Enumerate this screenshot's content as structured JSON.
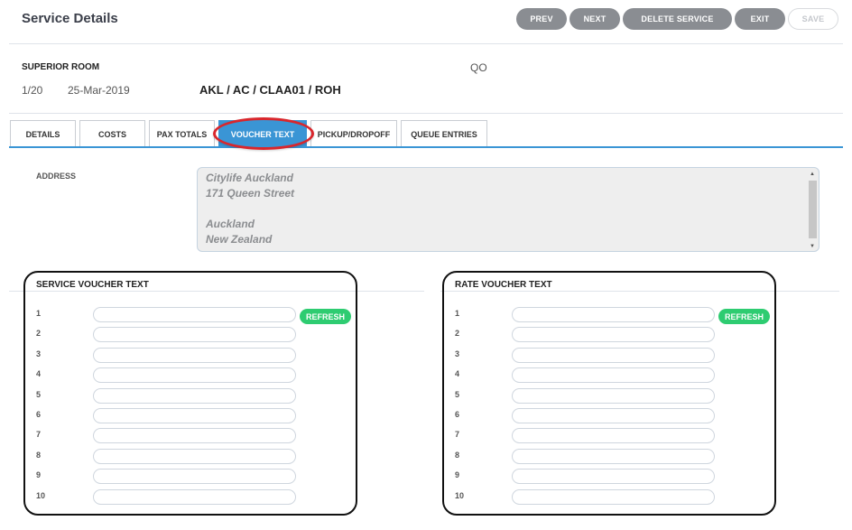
{
  "page": {
    "title": "Service Details"
  },
  "toolbar": {
    "prev": "PREV",
    "next": "NEXT",
    "delete": "DELETE SERVICE",
    "exit": "EXIT",
    "save": "SAVE"
  },
  "service": {
    "room": "SUPERIOR ROOM",
    "code": "QO",
    "index": "1/20",
    "date": "25-Mar-2019",
    "route": "AKL / AC / CLAA01 / ROH"
  },
  "tabs": [
    {
      "label": "DETAILS",
      "active": false
    },
    {
      "label": "COSTS",
      "active": false
    },
    {
      "label": "PAX TOTALS",
      "active": false
    },
    {
      "label": "VOUCHER TEXT",
      "active": true
    },
    {
      "label": "PICKUP/DROPOFF",
      "active": false
    },
    {
      "label": "QUEUE ENTRIES",
      "active": false
    }
  ],
  "address": {
    "label": "ADDRESS",
    "lines": [
      "Citylife Auckland",
      "171 Queen Street",
      "",
      "Auckland",
      "New Zealand"
    ]
  },
  "service_voucher": {
    "title": "SERVICE VOUCHER TEXT",
    "refresh": "REFRESH",
    "rows": [
      "1",
      "2",
      "3",
      "4",
      "5",
      "6",
      "7",
      "8",
      "9",
      "10"
    ]
  },
  "rate_voucher": {
    "title": "RATE VOUCHER TEXT",
    "refresh": "REFRESH",
    "rows": [
      "1",
      "2",
      "3",
      "4",
      "5",
      "6",
      "7",
      "8",
      "9",
      "10"
    ]
  },
  "colors": {
    "accent": "#3a95d5",
    "refresh": "#2ecc71",
    "toolbar_button": "#8a8d92",
    "highlight_ring": "#d9262c"
  }
}
